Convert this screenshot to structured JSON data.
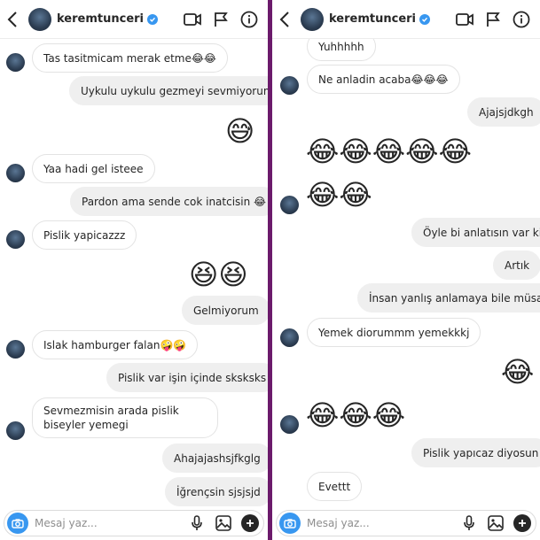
{
  "header": {
    "username": "keremtunceri"
  },
  "composer": {
    "placeholder": "Mesaj yaz..."
  },
  "left": {
    "m1": "Tas tasitmicam merak etme😂😂",
    "m2": "Uykulu uykulu gezmeyi sevmiyorum",
    "e1": "😅",
    "m3": "Yaa hadi gel isteee",
    "m4": "Pardon ama sende cok inatcisin 😂",
    "m5": "Pislik yapicazzz",
    "e2": "😆😆",
    "m6": "Gelmiyorum",
    "m7": "Islak hamburger falan🤪🤪",
    "m8": "Pislik var işin içinde sksksks",
    "m9": "Sevmezmisin arada pislik biseyler yemegi",
    "m10": "Ahajajashsjfkglg",
    "m11": "İğrençsin sjsjsjd"
  },
  "right": {
    "m1": "Yuhhhhh",
    "m2": "Ne anladin acaba😂😂😂",
    "m3": "Ajajsjdkgh",
    "e1": "😂😂😂😂😂",
    "e2": "😂😂",
    "m4": "Öyle bi anlatısın var ki",
    "m5": "Artık",
    "m6": "İnsan yanlış anlamaya bile müsait",
    "m7": "Yemek diorummm yemekkkj",
    "e3": "😂",
    "e4": "😂😂😂",
    "m8": "Pislik yapıcaz diyosun",
    "m9": "Evettt"
  }
}
